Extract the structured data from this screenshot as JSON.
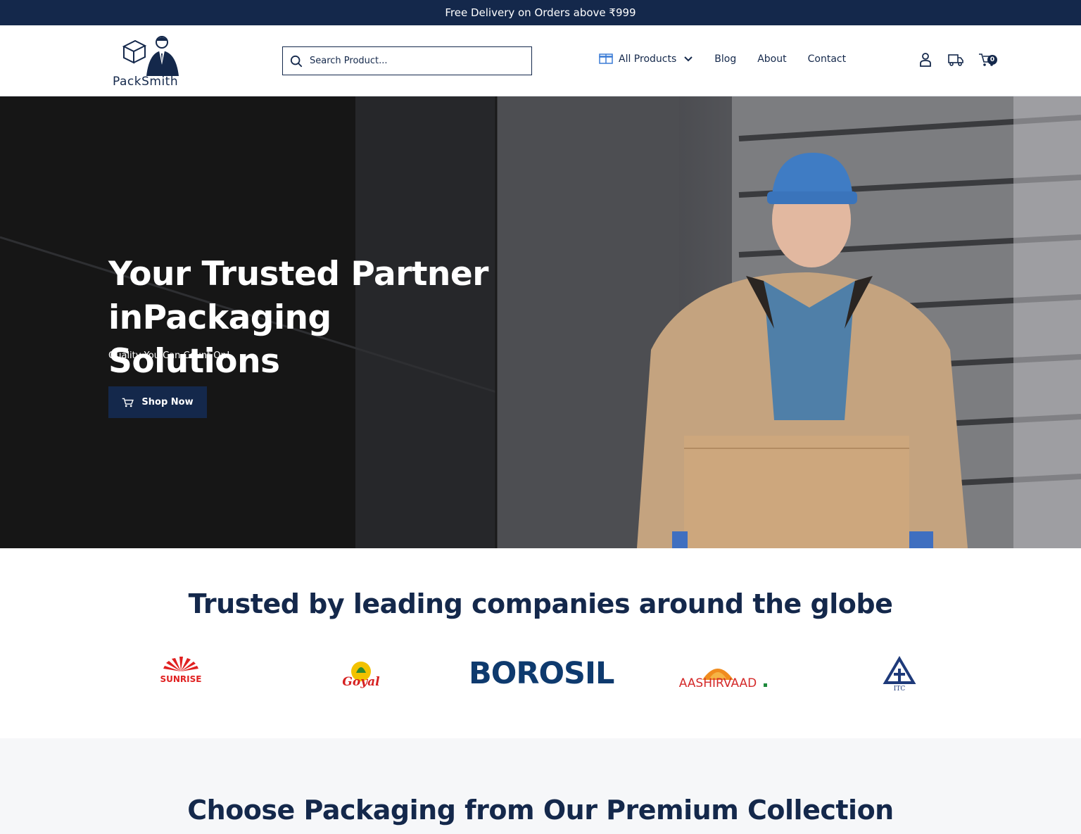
{
  "topbar": {
    "text": "Free Delivery on Orders above ₹999"
  },
  "header": {
    "logo_text": "PackSmith",
    "search": {
      "placeholder": "Search Product..."
    },
    "nav": [
      {
        "label": "All Products",
        "icon": "box-icon",
        "has_dropdown": true
      },
      {
        "label": "Blog"
      },
      {
        "label": "About"
      },
      {
        "label": "Contact"
      }
    ],
    "icons": [
      "user-icon",
      "delivery-truck-icon",
      "cart-icon"
    ],
    "cart_count": "0"
  },
  "hero": {
    "title": "Your Trusted Partner inPackaging Solutions",
    "subtitle": "Quality You Can Count On!",
    "cta_label": "Shop Now"
  },
  "trusted": {
    "title": "Trusted by leading companies around the globe",
    "brands": [
      "SUNRISE",
      "Goyal",
      "BOROSIL",
      "AASHIRVAAD",
      "ITC"
    ]
  },
  "premium": {
    "title": "Choose Packaging from Our Premium Collection"
  },
  "colors": {
    "primary": "#14284b",
    "background_light": "#f6f7f9",
    "white": "#ffffff"
  }
}
